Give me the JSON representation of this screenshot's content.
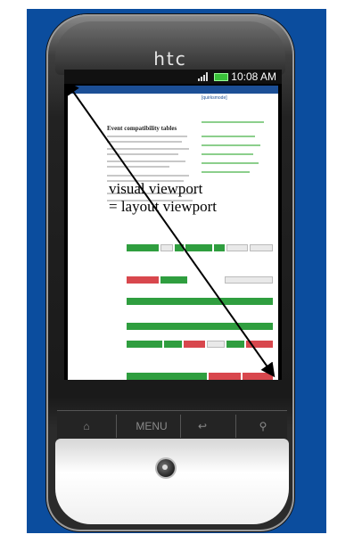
{
  "phone": {
    "brand": "htc",
    "status_time": "10:08 AM"
  },
  "webpage": {
    "site_tag": "[quirksmode]",
    "heading": "Event compatibility tables"
  },
  "annotation": {
    "line1": "visual viewport",
    "line2": "= layout viewport"
  },
  "icons": {
    "home": "home-icon",
    "menu": "MENU",
    "back": "back-icon",
    "search": "search-icon",
    "signal": "signal-icon",
    "battery": "battery-icon",
    "trackball": "trackball-icon"
  },
  "colors": {
    "backdrop": "#0b4d9e",
    "arrow": "#000000",
    "green": "#2f9e3f",
    "red": "#d8474d"
  }
}
